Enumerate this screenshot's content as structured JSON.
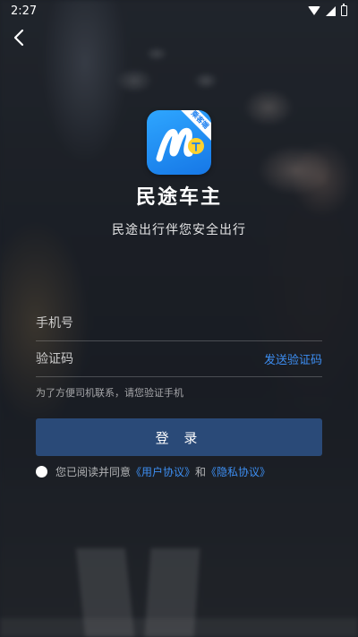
{
  "status_bar": {
    "time": "2:27"
  },
  "app": {
    "name": "民途车主",
    "slogan": "民途出行伴您安全出行",
    "badge": "乘客端"
  },
  "form": {
    "phone_placeholder": "手机号",
    "code_placeholder": "验证码",
    "send_code_label": "发送验证码",
    "hint": "为了方便司机联系，请您验证手机"
  },
  "login_button": "登 录",
  "agreement": {
    "prefix": "您已阅读并同意",
    "user_agreement": "《用户协议》",
    "and": "和",
    "privacy_policy": "《隐私协议》"
  },
  "colors": {
    "accent": "#3d8ef2",
    "login_button": "#2a4a78",
    "logo": "#1b82f0"
  }
}
